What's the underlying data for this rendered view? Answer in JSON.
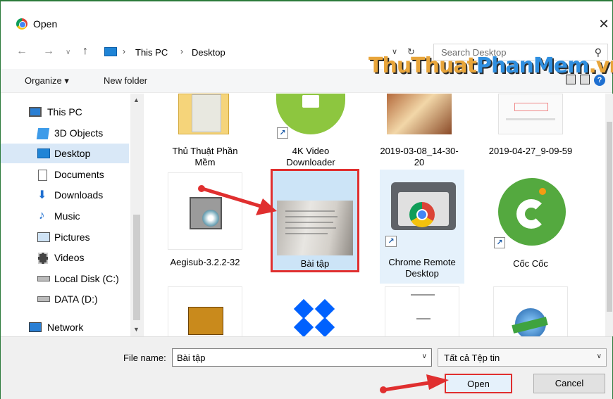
{
  "window": {
    "title": "Open",
    "close_glyph": "✕"
  },
  "address": {
    "crumbs": [
      "This PC",
      "Desktop"
    ],
    "separator": "›",
    "search_placeholder": "Search Desktop"
  },
  "watermark": {
    "part1": "ThuThuat",
    "part2": "PhanMem",
    "part3": ".vn"
  },
  "toolbar": {
    "organize": "Organize ▾",
    "new_folder": "New folder"
  },
  "sidebar": {
    "items": [
      {
        "label": "This PC",
        "icon": "pc-icon"
      },
      {
        "label": "3D Objects",
        "icon": "3d-objects-icon"
      },
      {
        "label": "Desktop",
        "icon": "desktop-icon",
        "selected": true
      },
      {
        "label": "Documents",
        "icon": "documents-icon"
      },
      {
        "label": "Downloads",
        "icon": "downloads-icon"
      },
      {
        "label": "Music",
        "icon": "music-icon"
      },
      {
        "label": "Pictures",
        "icon": "pictures-icon"
      },
      {
        "label": "Videos",
        "icon": "videos-icon"
      },
      {
        "label": "Local Disk (C:)",
        "icon": "drive-icon"
      },
      {
        "label": "DATA (D:)",
        "icon": "drive-icon"
      },
      {
        "label": "Network",
        "icon": "network-icon"
      }
    ]
  },
  "files": {
    "row1": [
      "Thủ Thuật Phần Mềm",
      "4K Video Downloader",
      "2019-03-08_14-30-20",
      "2019-04-27_9-09-59"
    ],
    "row2": [
      "Aegisub-3.2.2-32",
      "Bài tập",
      "Chrome Remote Desktop",
      "Cốc Cốc"
    ]
  },
  "bottom": {
    "file_name_label": "File name:",
    "file_name_value": "Bài tập",
    "file_type": "Tất cả Tệp tin",
    "open": "Open",
    "cancel": "Cancel"
  },
  "colors": {
    "accent": "#e02f2f",
    "selection": "#cce4f7",
    "folder_blue": "#1f84d6"
  }
}
